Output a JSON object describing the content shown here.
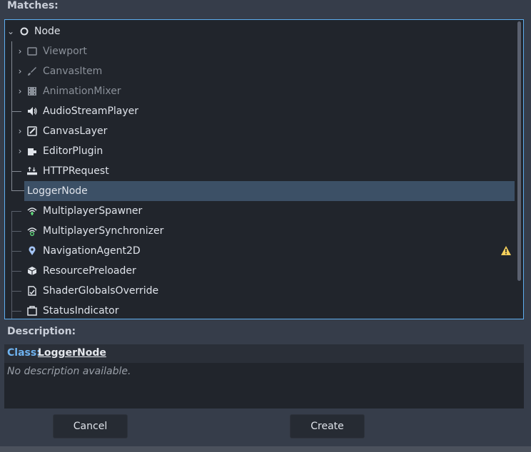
{
  "matches_label": "Matches:",
  "tree": {
    "root": {
      "label": "Node",
      "icon": "circle-node-icon"
    },
    "items": [
      {
        "label": "Viewport",
        "icon": "viewport-icon",
        "expandable": true,
        "dim": true
      },
      {
        "label": "CanvasItem",
        "icon": "brush-icon",
        "expandable": true,
        "dim": true
      },
      {
        "label": "AnimationMixer",
        "icon": "film-icon",
        "expandable": true,
        "dim": true
      },
      {
        "label": "AudioStreamPlayer",
        "icon": "speaker-icon",
        "expandable": false,
        "dim": false
      },
      {
        "label": "CanvasLayer",
        "icon": "canvas-layer-icon",
        "expandable": true,
        "dim": false
      },
      {
        "label": "EditorPlugin",
        "icon": "plugin-icon",
        "expandable": true,
        "dim": false
      },
      {
        "label": "HTTPRequest",
        "icon": "http-icon",
        "expandable": false,
        "dim": false
      },
      {
        "label": "LoggerNode",
        "icon": "",
        "expandable": false,
        "dim": false,
        "selected": true
      },
      {
        "label": "MultiplayerSpawner",
        "icon": "multiplayer-spawner-icon",
        "expandable": false,
        "dim": false
      },
      {
        "label": "MultiplayerSynchronizer",
        "icon": "multiplayer-sync-icon",
        "expandable": false,
        "dim": false
      },
      {
        "label": "NavigationAgent2D",
        "icon": "map-pin-icon",
        "expandable": false,
        "dim": false,
        "warning": true
      },
      {
        "label": "ResourcePreloader",
        "icon": "cube-icon",
        "expandable": false,
        "dim": false
      },
      {
        "label": "ShaderGlobalsOverride",
        "icon": "shader-globals-icon",
        "expandable": false,
        "dim": false
      },
      {
        "label": "StatusIndicator",
        "icon": "status-indicator-icon",
        "expandable": false,
        "dim": false
      }
    ]
  },
  "description": {
    "label": "Description:",
    "class_prefix": "Class:",
    "class_name": "LoggerNode",
    "text": "No description available."
  },
  "buttons": {
    "cancel": "Cancel",
    "create": "Create"
  },
  "colors": {
    "accent": "#5eaef0",
    "selection": "#3c5066",
    "warning": "#f5d05b",
    "multiplayer": "#5fdb7a"
  }
}
